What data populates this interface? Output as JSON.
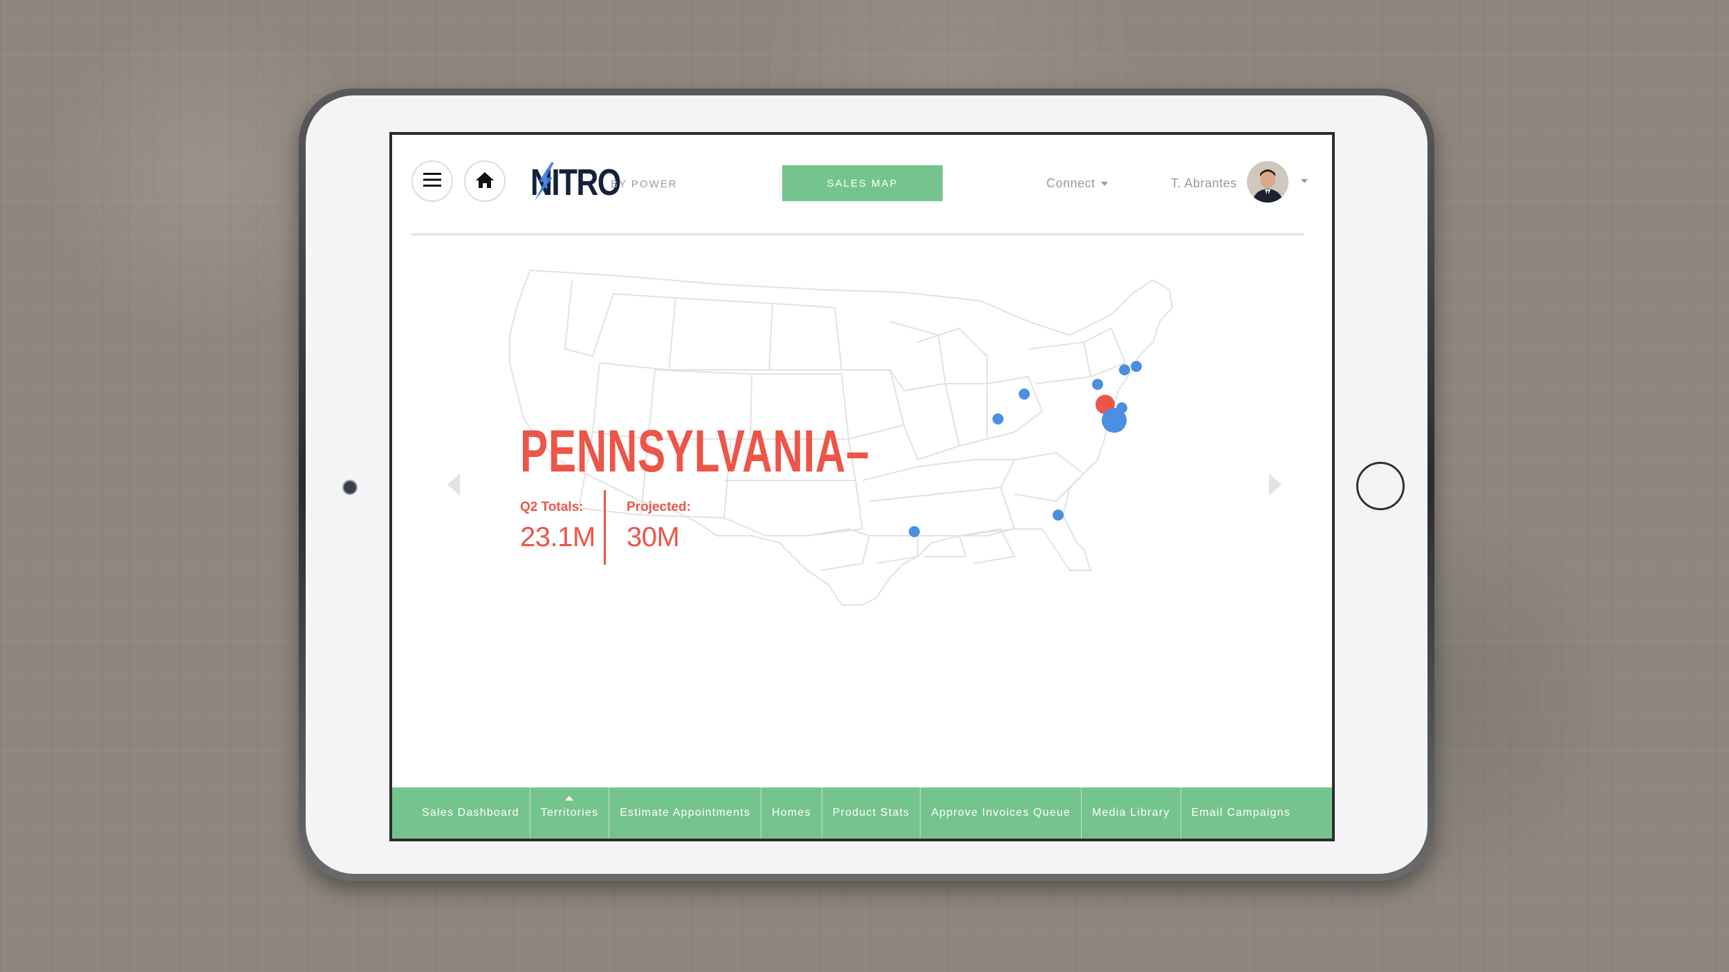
{
  "app": {
    "logo_text": "NITRO",
    "logo_sub": "BY POWER"
  },
  "header": {
    "primary_button": "SALES MAP",
    "connect_label": "Connect",
    "user_name": "T. Abrantes"
  },
  "map": {
    "selected_state": "PENNSYLVANIA–",
    "stats": [
      {
        "label": "Q2 Totals:",
        "value": "23.1M"
      },
      {
        "label": "Projected:",
        "value": "30M"
      }
    ],
    "markers": [
      {
        "state": "Vermont / New Hampshire",
        "size": "small",
        "color": "#4a8fe2"
      },
      {
        "state": "Vermont",
        "size": "small",
        "color": "#4a8fe2"
      },
      {
        "state": "New York",
        "size": "small",
        "color": "#4a8fe2"
      },
      {
        "state": "Michigan",
        "size": "small",
        "color": "#4a8fe2"
      },
      {
        "state": "Illinois",
        "size": "small",
        "color": "#4a8fe2"
      },
      {
        "state": "Pennsylvania",
        "size": "medium",
        "color": "#ec5548"
      },
      {
        "state": "New Jersey",
        "size": "small",
        "color": "#4a8fe2"
      },
      {
        "state": "Maryland / Delaware",
        "size": "large",
        "color": "#4a8fe2"
      },
      {
        "state": "Georgia",
        "size": "small",
        "color": "#4a8fe2"
      },
      {
        "state": "Texas",
        "size": "small",
        "color": "#4a8fe2"
      }
    ]
  },
  "bottom_nav": {
    "items": [
      {
        "label": "Sales Dashboard"
      },
      {
        "label": "Territories",
        "active": true
      },
      {
        "label": "Estimate Appointments"
      },
      {
        "label": "Homes"
      },
      {
        "label": "Product Stats"
      },
      {
        "label": "Approve Invoices Queue"
      },
      {
        "label": "Media Library"
      },
      {
        "label": "Email Campaigns"
      }
    ]
  },
  "colors": {
    "accent_green": "#76c48d",
    "highlight_red": "#ec5548",
    "marker_blue": "#4a8fe2",
    "logo_navy": "#13223a",
    "logo_bolt_blue": "#3b7be6"
  }
}
